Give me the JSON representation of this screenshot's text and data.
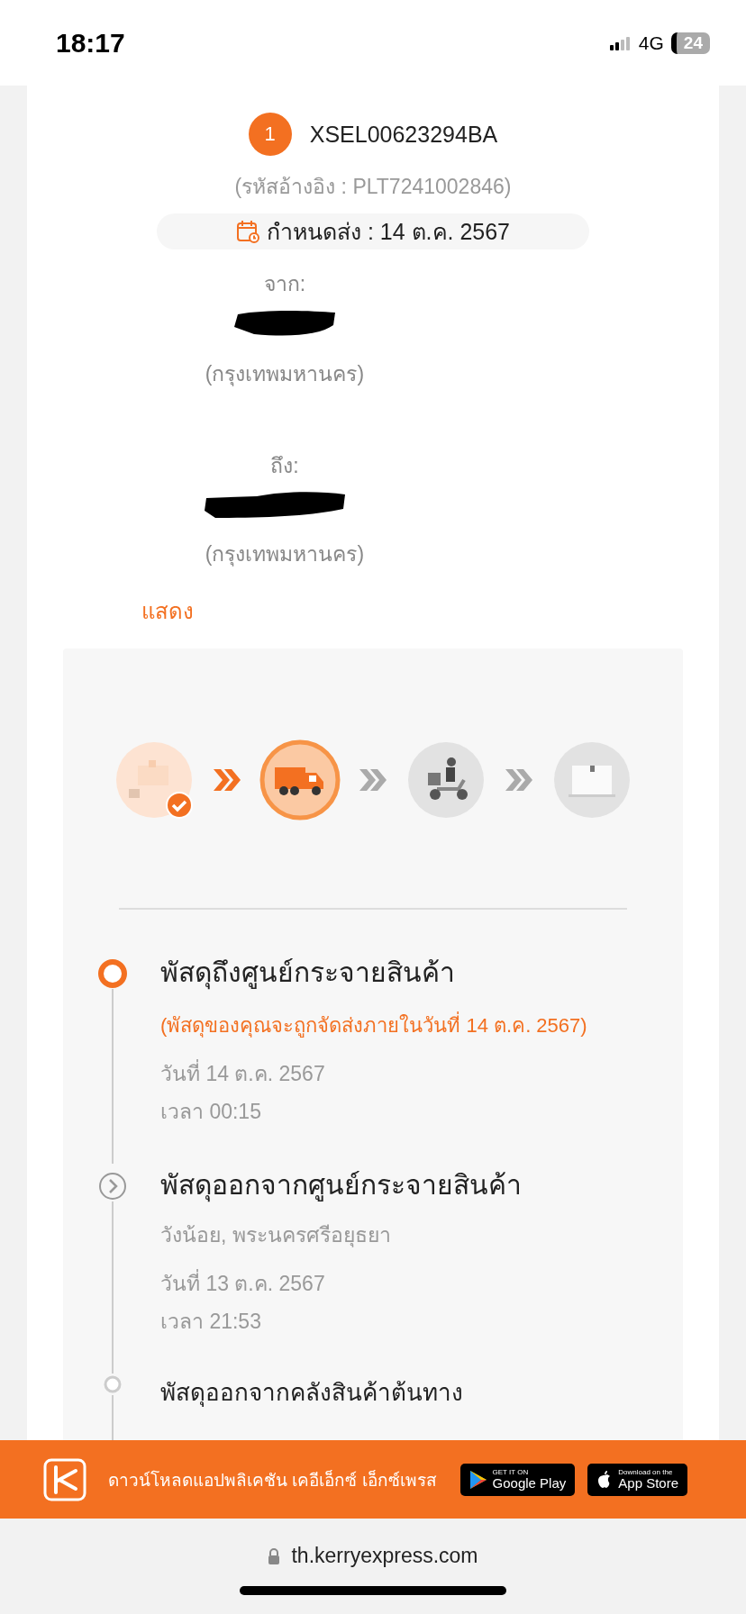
{
  "status_bar": {
    "time": "18:17",
    "network": "4G",
    "battery": "24"
  },
  "shipment": {
    "index": "1",
    "tracking_number": "XSEL00623294BA",
    "reference": "(รหัสอ้างอิง : PLT7241002846)",
    "due": "กำหนดส่ง : 14 ต.ค. 2567"
  },
  "sender": {
    "label": "จาก:",
    "name_redacted": true,
    "city": "(กรุงเทพมหานคร)"
  },
  "recipient": {
    "label": "ถึง:",
    "name_redacted": true,
    "city": "(กรุงเทพมหานคร)"
  },
  "show_link": "แสดง",
  "progress_steps": [
    {
      "kind": "pickup",
      "completed": true,
      "current": false
    },
    {
      "kind": "truck",
      "completed": false,
      "current": true
    },
    {
      "kind": "scooter",
      "completed": false,
      "current": false
    },
    {
      "kind": "delivered",
      "completed": false,
      "current": false
    }
  ],
  "timeline": [
    {
      "kind": "current",
      "title": "พัสดุถึงศูนย์กระจายสินค้า",
      "note": "(พัสดุของคุณจะถูกจัดส่งภายในวันที่ 14 ต.ค. 2567)",
      "date": "วันที่ 14 ต.ค. 2567",
      "time": "เวลา 00:15"
    },
    {
      "kind": "passed",
      "title": "พัสดุออกจากศูนย์กระจายสินค้า",
      "location": "วังน้อย, พระนครศรีอยุธยา",
      "date": "วันที่ 13 ต.ค. 2567",
      "time": "เวลา 21:53"
    },
    {
      "kind": "earlier",
      "title": "พัสดุออกจากคลังสินค้าต้นทาง"
    }
  ],
  "app_banner": {
    "text": "ดาวน์โหลดแอปพลิเคชัน เคอีเอ็กซ์ เอ็กซ์เพรส",
    "stores": [
      {
        "kind": "google",
        "caption": "GET IT ON",
        "name": "Google Play"
      },
      {
        "kind": "apple",
        "caption": "Download on the",
        "name": "App Store"
      }
    ]
  },
  "browser": {
    "url": "th.kerryexpress.com"
  }
}
